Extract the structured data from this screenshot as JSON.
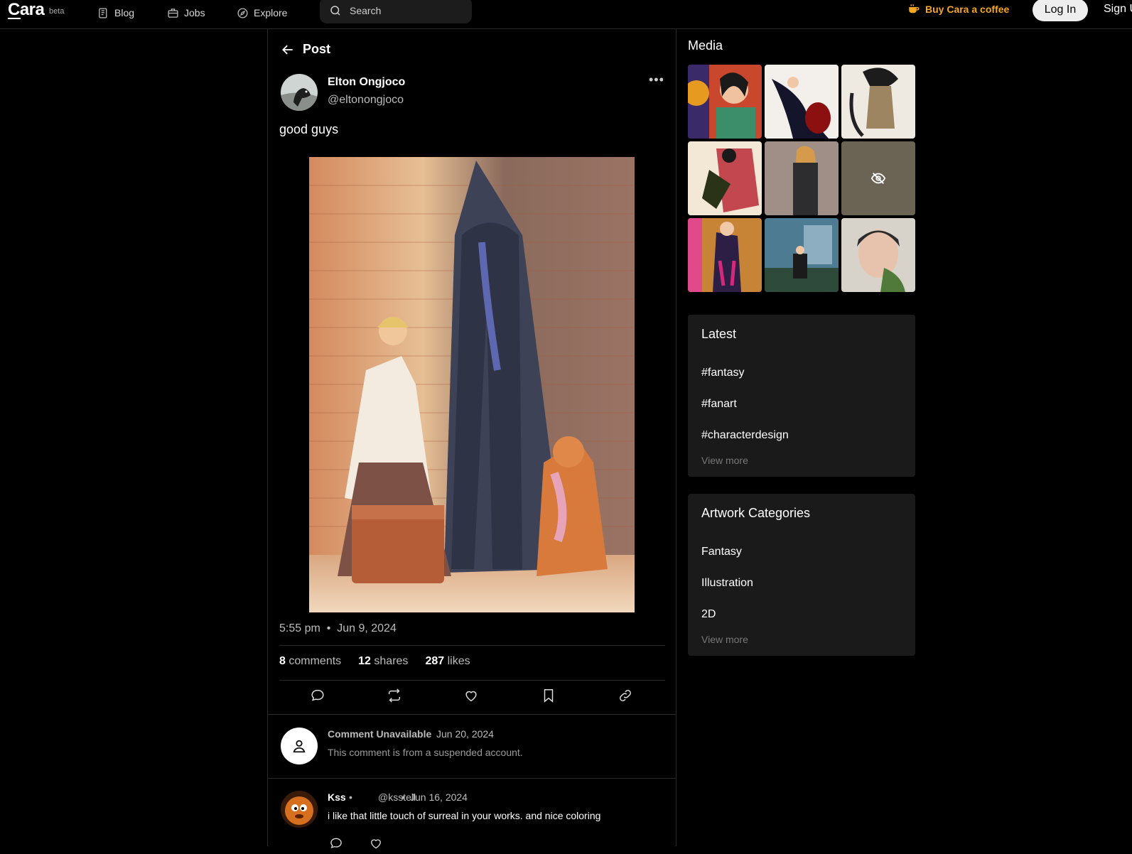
{
  "nav": {
    "logo": "Cara",
    "beta": "beta",
    "items": [
      {
        "label": "Blog",
        "icon": "newspaper-icon"
      },
      {
        "label": "Jobs",
        "icon": "briefcase-icon"
      },
      {
        "label": "Explore",
        "icon": "compass-icon"
      }
    ],
    "search_placeholder": "Search",
    "coffee_label": "Buy Cara a coffee",
    "login_label": "Log In",
    "signup_label": "Sign Up"
  },
  "post": {
    "header": "Post",
    "author_name": "Elton Ongjoco",
    "author_handle": "@eltonongjoco",
    "text": "good guys",
    "time": "5:55 pm",
    "date": "Jun 9, 2024",
    "comments_count": "8",
    "comments_label": "comments",
    "shares_count": "12",
    "shares_label": "shares",
    "likes_count": "287",
    "likes_label": "likes"
  },
  "comments": [
    {
      "name": "Comment Unavailable",
      "date": "Jun 20, 2024",
      "body": "This comment is from a suspended account."
    },
    {
      "name": "Kss",
      "handle": "@ksstell",
      "date": "Jun 16, 2024",
      "body": "i like that little touch of surreal in your works. and nice coloring"
    }
  ],
  "sidebar": {
    "media_title": "Media",
    "latest": {
      "title": "Latest",
      "items": [
        "#fantasy",
        "#fanart",
        "#characterdesign"
      ],
      "more": "View more"
    },
    "categories": {
      "title": "Artwork Categories",
      "items": [
        "Fantasy",
        "Illustration",
        "2D"
      ],
      "more": "View more"
    }
  },
  "colors": {
    "accent": "#f5a623",
    "panel": "#1a1a1a",
    "border": "#2a2a2a"
  }
}
